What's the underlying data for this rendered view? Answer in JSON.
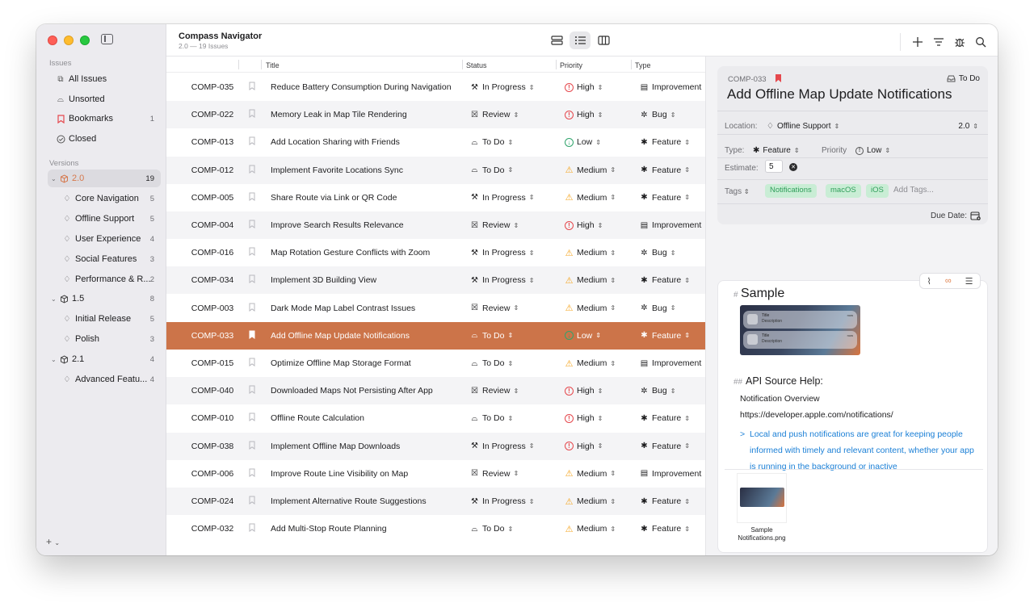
{
  "app": {
    "title": "Compass Navigator",
    "subtitle": "2.0 — 19 Issues"
  },
  "sidebar": {
    "issues_header": "Issues",
    "issues": [
      {
        "label": "All Issues",
        "count": ""
      },
      {
        "label": "Unsorted",
        "count": ""
      },
      {
        "label": "Bookmarks",
        "count": "1"
      },
      {
        "label": "Closed",
        "count": ""
      }
    ],
    "versions_header": "Versions",
    "versions": [
      {
        "label": "2.0",
        "count": "19"
      },
      {
        "label": "Core Navigation",
        "count": "5"
      },
      {
        "label": "Offline Support",
        "count": "5"
      },
      {
        "label": "User Experience",
        "count": "4"
      },
      {
        "label": "Social Features",
        "count": "3"
      },
      {
        "label": "Performance & R...",
        "count": "2"
      },
      {
        "label": "1.5",
        "count": "8"
      },
      {
        "label": "Initial Release",
        "count": "5"
      },
      {
        "label": "Polish",
        "count": "3"
      },
      {
        "label": "2.1",
        "count": "4"
      },
      {
        "label": "Advanced Featu...",
        "count": "4"
      }
    ],
    "add_label": "+"
  },
  "list": {
    "headers": {
      "title": "Title",
      "status": "Status",
      "priority": "Priority",
      "type": "Type"
    },
    "rows": [
      {
        "id": "COMP-035",
        "title": "Reduce Battery Consumption During Navigation",
        "status": "In Progress",
        "priority": "High",
        "type": "Improvement"
      },
      {
        "id": "COMP-022",
        "title": "Memory Leak in Map Tile Rendering",
        "status": "Review",
        "priority": "High",
        "type": "Bug"
      },
      {
        "id": "COMP-013",
        "title": "Add Location Sharing with Friends",
        "status": "To Do",
        "priority": "Low",
        "type": "Feature"
      },
      {
        "id": "COMP-012",
        "title": "Implement Favorite Locations Sync",
        "status": "To Do",
        "priority": "Medium",
        "type": "Feature"
      },
      {
        "id": "COMP-005",
        "title": "Share Route via Link or QR Code",
        "status": "In Progress",
        "priority": "Medium",
        "type": "Feature"
      },
      {
        "id": "COMP-004",
        "title": "Improve Search Results Relevance",
        "status": "Review",
        "priority": "High",
        "type": "Improvement"
      },
      {
        "id": "COMP-016",
        "title": "Map Rotation Gesture Conflicts with Zoom",
        "status": "In Progress",
        "priority": "Medium",
        "type": "Bug"
      },
      {
        "id": "COMP-034",
        "title": "Implement 3D Building View",
        "status": "In Progress",
        "priority": "Medium",
        "type": "Feature"
      },
      {
        "id": "COMP-003",
        "title": "Dark Mode Map Label Contrast Issues",
        "status": "Review",
        "priority": "Medium",
        "type": "Bug"
      },
      {
        "id": "COMP-033",
        "title": "Add Offline Map Update Notifications",
        "status": "To Do",
        "priority": "Low",
        "type": "Feature"
      },
      {
        "id": "COMP-015",
        "title": "Optimize Offline Map Storage Format",
        "status": "To Do",
        "priority": "Medium",
        "type": "Improvement"
      },
      {
        "id": "COMP-040",
        "title": "Downloaded Maps Not Persisting After App",
        "status": "Review",
        "priority": "High",
        "type": "Bug"
      },
      {
        "id": "COMP-010",
        "title": "Offline Route Calculation",
        "status": "To Do",
        "priority": "High",
        "type": "Feature"
      },
      {
        "id": "COMP-038",
        "title": "Implement Offline Map Downloads",
        "status": "In Progress",
        "priority": "High",
        "type": "Feature"
      },
      {
        "id": "COMP-006",
        "title": "Improve Route Line Visibility on Map",
        "status": "Review",
        "priority": "Medium",
        "type": "Improvement"
      },
      {
        "id": "COMP-024",
        "title": "Implement Alternative Route Suggestions",
        "status": "In Progress",
        "priority": "Medium",
        "type": "Feature"
      },
      {
        "id": "COMP-032",
        "title": "Add Multi-Stop Route Planning",
        "status": "To Do",
        "priority": "Medium",
        "type": "Feature"
      }
    ]
  },
  "inspector": {
    "issue_id": "COMP-033",
    "status": "To Do",
    "title": "Add Offline Map Update Notifications",
    "location_label": "Location:",
    "location_value": "Offline Support",
    "version_value": "2.0",
    "type_label": "Type:",
    "type_value": "Feature",
    "priority_label": "Priority",
    "priority_value": "Low",
    "estimate_label": "Estimate:",
    "estimate_value": "5",
    "tags_label": "Tags",
    "tags": [
      "Notifications",
      "macOS",
      "iOS"
    ],
    "add_tags_placeholder": "Add Tags...",
    "due_label": "Due Date:"
  },
  "note": {
    "h1_marker": "#",
    "h1": "Sample",
    "thumb_title": "Title",
    "thumb_desc": "Description",
    "thumb_time": "now",
    "h2_marker": "##",
    "h2": "API Source Help:",
    "line1": "Notification Overview",
    "line2": "https://developer.apple.com/notifications/",
    "quote_marker": ">",
    "quote": "Local and push notifications are great for keeping people informed with timely and relevant content, whether your app is running in the background or inactive",
    "attachment_label": "Sample Notifications.png"
  },
  "colors": {
    "accent": "#cc7449",
    "high": "#e5484d",
    "low": "#30a46c",
    "medium": "#f5a623",
    "tag_bg": "#c9edd5",
    "link": "#1a7fd6"
  }
}
